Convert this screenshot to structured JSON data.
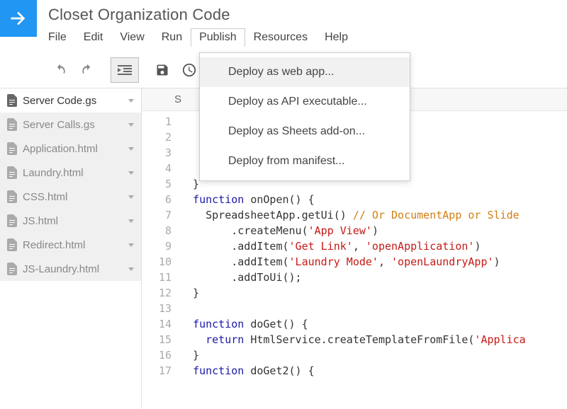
{
  "header": {
    "title": "Closet Organization Code",
    "menu": [
      "File",
      "Edit",
      "View",
      "Run",
      "Publish",
      "Resources",
      "Help"
    ]
  },
  "dropdown": {
    "items": [
      "Deploy as web app...",
      "Deploy as API executable...",
      "Deploy as Sheets add-on...",
      "Deploy from manifest..."
    ]
  },
  "sidebar": {
    "files": [
      {
        "name": "Server Code.gs",
        "active": true
      },
      {
        "name": "Server Calls.gs",
        "active": false
      },
      {
        "name": "Application.html",
        "active": false
      },
      {
        "name": "Laundry.html",
        "active": false
      },
      {
        "name": "CSS.html",
        "active": false
      },
      {
        "name": "JS.html",
        "active": false
      },
      {
        "name": "Redirect.html",
        "active": false
      },
      {
        "name": "JS-Laundry.html",
        "active": false
      }
    ]
  },
  "func_selector": "S",
  "code": {
    "start_line": 1,
    "lines": [
      {
        "t": "    ",
        "plain": true
      },
      {
        "t": "    ",
        "plain": true
      },
      {
        "t": "    ",
        "plain": true,
        "faded": "      "
      },
      {
        "t": "",
        "plain": true
      },
      {
        "t": "  }",
        "plain": true
      },
      {
        "tokens": [
          [
            "  ",
            ""
          ],
          [
            "function ",
            "kw"
          ],
          [
            "onOpen",
            ""
          ],
          [
            "() {",
            ""
          ]
        ]
      },
      {
        "tokens": [
          [
            "    SpreadsheetApp.getUi() ",
            ""
          ],
          [
            "// Or DocumentApp or Slide",
            "com"
          ]
        ]
      },
      {
        "tokens": [
          [
            "        .createMenu(",
            ""
          ],
          [
            "'App View'",
            "str"
          ],
          [
            ")",
            ""
          ]
        ]
      },
      {
        "tokens": [
          [
            "        .addItem(",
            ""
          ],
          [
            "'Get Link'",
            "str"
          ],
          [
            ", ",
            ""
          ],
          [
            "'openApplication'",
            "str"
          ],
          [
            ")",
            ""
          ]
        ]
      },
      {
        "tokens": [
          [
            "        .addItem(",
            ""
          ],
          [
            "'Laundry Mode'",
            "str"
          ],
          [
            ", ",
            ""
          ],
          [
            "'openLaundryApp'",
            "str"
          ],
          [
            ")",
            ""
          ]
        ]
      },
      {
        "tokens": [
          [
            "        .addToUi();",
            ""
          ]
        ]
      },
      {
        "t": "  }",
        "plain": true
      },
      {
        "t": "",
        "plain": true
      },
      {
        "tokens": [
          [
            "  ",
            ""
          ],
          [
            "function ",
            "kw"
          ],
          [
            "doGet",
            ""
          ],
          [
            "() {",
            ""
          ]
        ]
      },
      {
        "tokens": [
          [
            "    ",
            ""
          ],
          [
            "return ",
            "kw"
          ],
          [
            "HtmlService.createTemplateFromFile(",
            ""
          ],
          [
            "'Applica",
            "str"
          ]
        ]
      },
      {
        "t": "  }",
        "plain": true
      },
      {
        "tokens": [
          [
            "  ",
            ""
          ],
          [
            "function ",
            "kw"
          ],
          [
            "doGet2",
            ""
          ],
          [
            "() {",
            ""
          ]
        ]
      }
    ]
  }
}
